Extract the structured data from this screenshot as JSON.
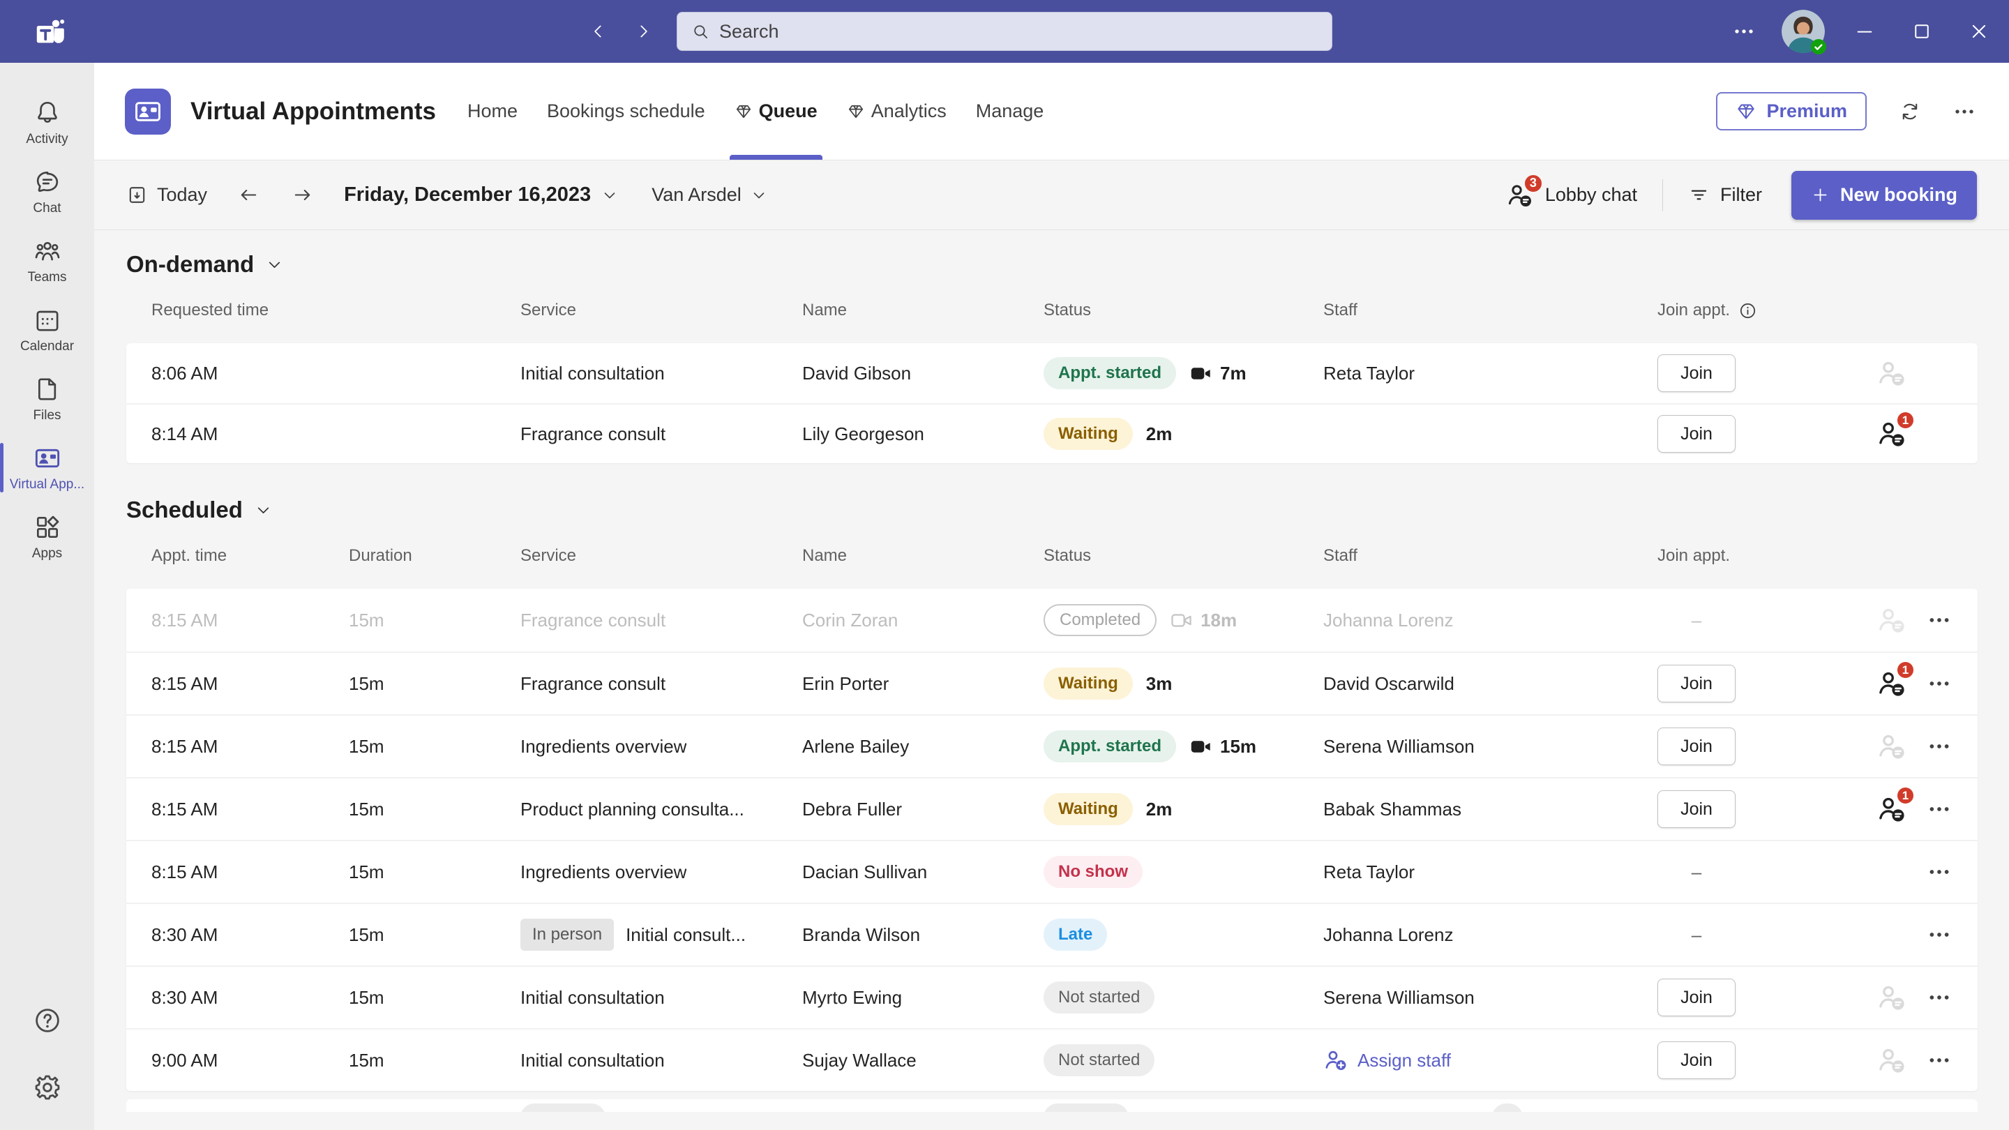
{
  "titlebar": {
    "search_placeholder": "Search"
  },
  "sidebar": {
    "items": [
      {
        "id": "activity",
        "icon": "bell",
        "label": "Activity"
      },
      {
        "id": "chat",
        "icon": "chat",
        "label": "Chat"
      },
      {
        "id": "teams",
        "icon": "people",
        "label": "Teams"
      },
      {
        "id": "calendar",
        "icon": "calendar",
        "label": "Calendar"
      },
      {
        "id": "files",
        "icon": "file",
        "label": "Files"
      },
      {
        "id": "virtual-appointments",
        "icon": "virtual-appt",
        "label": "Virtual App...",
        "active": true
      },
      {
        "id": "apps",
        "icon": "apps",
        "label": "Apps"
      }
    ]
  },
  "app_header": {
    "title": "Virtual Appointments",
    "tabs": [
      {
        "label": "Home"
      },
      {
        "label": "Bookings schedule"
      },
      {
        "label": "Queue",
        "premium": true,
        "active": true
      },
      {
        "label": "Analytics",
        "premium": true
      },
      {
        "label": "Manage"
      }
    ],
    "premium_label": "Premium"
  },
  "toolbar": {
    "today_label": "Today",
    "date_label": "Friday, December 16,2023",
    "org_label": "Van Arsdel",
    "lobby_chat_label": "Lobby chat",
    "lobby_badge": "3",
    "filter_label": "Filter",
    "new_booking_label": "New booking"
  },
  "labels": {
    "join": "Join",
    "dash": "–",
    "assign_staff": "Assign staff"
  },
  "ondemand": {
    "title": "On-demand",
    "columns": [
      "Requested time",
      "Service",
      "Name",
      "Status",
      "Staff",
      "Join appt."
    ],
    "rows": [
      {
        "time": "8:06 AM",
        "service": "Initial consultation",
        "name": "David Gibson",
        "status": {
          "label": "Appt. started",
          "kind": "started"
        },
        "extra": {
          "icon": "camera-filled",
          "text": "7m"
        },
        "staff": "Reta Taylor",
        "join": "button",
        "attendee": "idle"
      },
      {
        "time": "8:14 AM",
        "service": "Fragrance consult",
        "name": "Lily Georgeson",
        "status": {
          "label": "Waiting",
          "kind": "waiting"
        },
        "extra": {
          "text": "2m"
        },
        "staff": "",
        "join": "button",
        "attendee": "badge",
        "badge": "1"
      }
    ]
  },
  "scheduled": {
    "title": "Scheduled",
    "columns": [
      "Appt. time",
      "Duration",
      "Service",
      "Name",
      "Status",
      "Staff",
      "Join appt."
    ],
    "rows": [
      {
        "time": "8:15 AM",
        "duration": "15m",
        "service": "Fragrance consult",
        "name": "Corin Zoran",
        "status": {
          "label": "Completed",
          "kind": "completed"
        },
        "extra": {
          "icon": "camera-outline",
          "text": "18m"
        },
        "staff": "Johanna Lorenz",
        "join": "dash",
        "attendee": "idle",
        "muted": true,
        "menu": true
      },
      {
        "time": "8:15 AM",
        "duration": "15m",
        "service": "Fragrance consult",
        "name": "Erin Porter",
        "status": {
          "label": "Waiting",
          "kind": "waiting"
        },
        "extra": {
          "text": "3m"
        },
        "staff": "David Oscarwild",
        "join": "button",
        "attendee": "badge",
        "badge": "1",
        "menu": true
      },
      {
        "time": "8:15 AM",
        "duration": "15m",
        "service": "Ingredients overview",
        "name": "Arlene Bailey",
        "status": {
          "label": "Appt. started",
          "kind": "started"
        },
        "extra": {
          "icon": "camera-filled",
          "text": "15m"
        },
        "staff": "Serena Williamson",
        "join": "button",
        "attendee": "idle",
        "menu": true
      },
      {
        "time": "8:15 AM",
        "duration": "15m",
        "service": "Product planning consulta...",
        "name": "Debra Fuller",
        "status": {
          "label": "Waiting",
          "kind": "waiting"
        },
        "extra": {
          "text": "2m"
        },
        "staff": "Babak Shammas",
        "join": "button",
        "attendee": "badge",
        "badge": "1",
        "menu": true
      },
      {
        "time": "8:15 AM",
        "duration": "15m",
        "service": "Ingredients overview",
        "name": "Dacian Sullivan",
        "status": {
          "label": "No show",
          "kind": "noshow"
        },
        "staff": "Reta Taylor",
        "join": "dash",
        "attendee": "none",
        "menu": true
      },
      {
        "time": "8:30 AM",
        "duration": "15m",
        "service": "Initial consult...",
        "service_tag": "In person",
        "name": "Branda Wilson",
        "status": {
          "label": "Late",
          "kind": "late"
        },
        "staff": "Johanna Lorenz",
        "join": "dash",
        "attendee": "none",
        "menu": true
      },
      {
        "time": "8:30 AM",
        "duration": "15m",
        "service": "Initial consultation",
        "name": "Myrto Ewing",
        "status": {
          "label": "Not started",
          "kind": "notstarted"
        },
        "staff": "Serena Williamson",
        "join": "button",
        "attendee": "idle",
        "menu": true
      },
      {
        "time": "9:00 AM",
        "duration": "15m",
        "service": "Initial consultation",
        "name": "Sujay Wallace",
        "status": {
          "label": "Not started",
          "kind": "notstarted"
        },
        "staff_assign": true,
        "join": "button",
        "attendee": "idle",
        "menu": true
      }
    ]
  },
  "colors": {
    "brand": "#5b5fc7",
    "titlebar": "#494f9c",
    "notification_badge": "#d13c2a",
    "status_started_bg": "#e7f2ec",
    "status_started_text": "#1f744c",
    "status_waiting_bg": "#fdf3d7",
    "status_waiting_text": "#8a5f00",
    "status_completed_border": "#c9c9c9",
    "status_completed_text": "#a3a3a3",
    "status_noshow_bg": "#fdeef2",
    "status_noshow_text": "#c4314b",
    "status_late_bg": "#e3f1fb",
    "status_late_text": "#1b8fe0",
    "status_notstarted_bg": "#ededed",
    "status_notstarted_text": "#5f5f5f",
    "presence_available": "#13a10e"
  }
}
